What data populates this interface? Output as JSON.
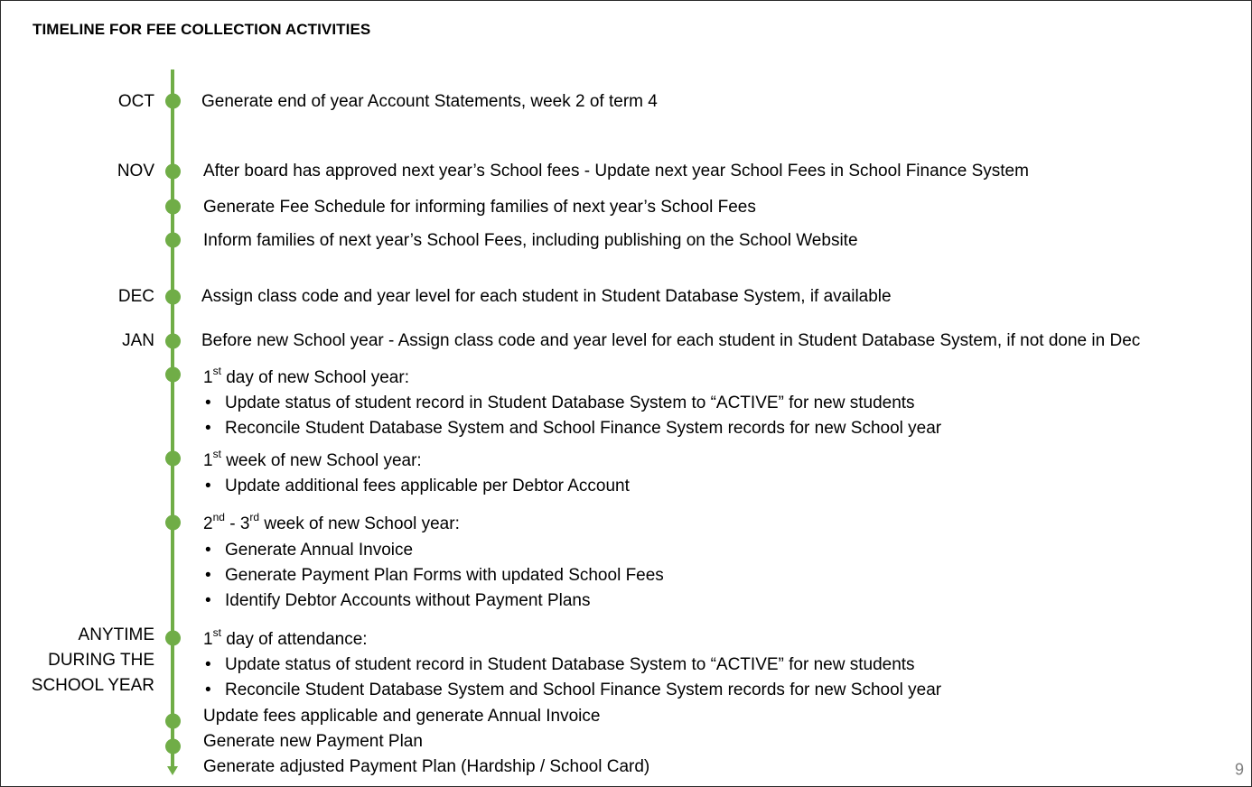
{
  "slide": {
    "title": "TIMELINE FOR FEE COLLECTION ACTIVITIES",
    "page_number": "9",
    "accent_color": "#70ad47"
  },
  "months": {
    "oct": "OCT",
    "nov": "NOV",
    "dec": "DEC",
    "jan": "JAN",
    "anytime": [
      "ANYTIME",
      "DURING THE",
      "SCHOOL YEAR"
    ]
  },
  "items": {
    "oct_1": "Generate end of year Account Statements, week 2 of term 4",
    "nov_1": "After board has approved next year’s School fees - Update next year School Fees in School Finance System",
    "nov_2": "Generate Fee Schedule for informing families of next year’s School Fees",
    "nov_3": "Inform families of next year’s School Fees, including publishing on the School Website",
    "dec_1": "Assign class code and year level for each student in Student Database System, if available",
    "jan_1": "Before new School year - Assign class code and year level for each student in Student Database System, if not done in Dec",
    "first_day": {
      "num": "1",
      "sup": "st",
      "rest": " day of new School year:",
      "bullets": [
        "Update status of student record in Student Database System to “ACTIVE” for new students",
        "Reconcile Student Database System and School Finance System records for new School year"
      ]
    },
    "first_week": {
      "num": "1",
      "sup": "st",
      "rest": " week of new School year:",
      "bullets": [
        "Update additional fees applicable per Debtor Account"
      ]
    },
    "second_third_week": {
      "num_a": "2",
      "sup_a": "nd",
      "mid": " - 3",
      "sup_b": "rd",
      "rest": " week of new School year:",
      "bullets": [
        "Generate Annual Invoice",
        "Generate Payment Plan Forms with updated School Fees",
        "Identify Debtor Accounts without Payment Plans"
      ]
    },
    "attendance": {
      "num": "1",
      "sup": "st",
      "rest": " day of attendance:",
      "bullets": [
        "Update status of student record in Student Database System to “ACTIVE” for new students",
        "Reconcile Student Database System and School Finance System records for new School year"
      ]
    },
    "update_fees": "Update fees applicable and generate Annual Invoice",
    "new_plan": "Generate new Payment Plan",
    "adjusted_plan": "Generate adjusted Payment Plan (Hardship / School Card)"
  }
}
